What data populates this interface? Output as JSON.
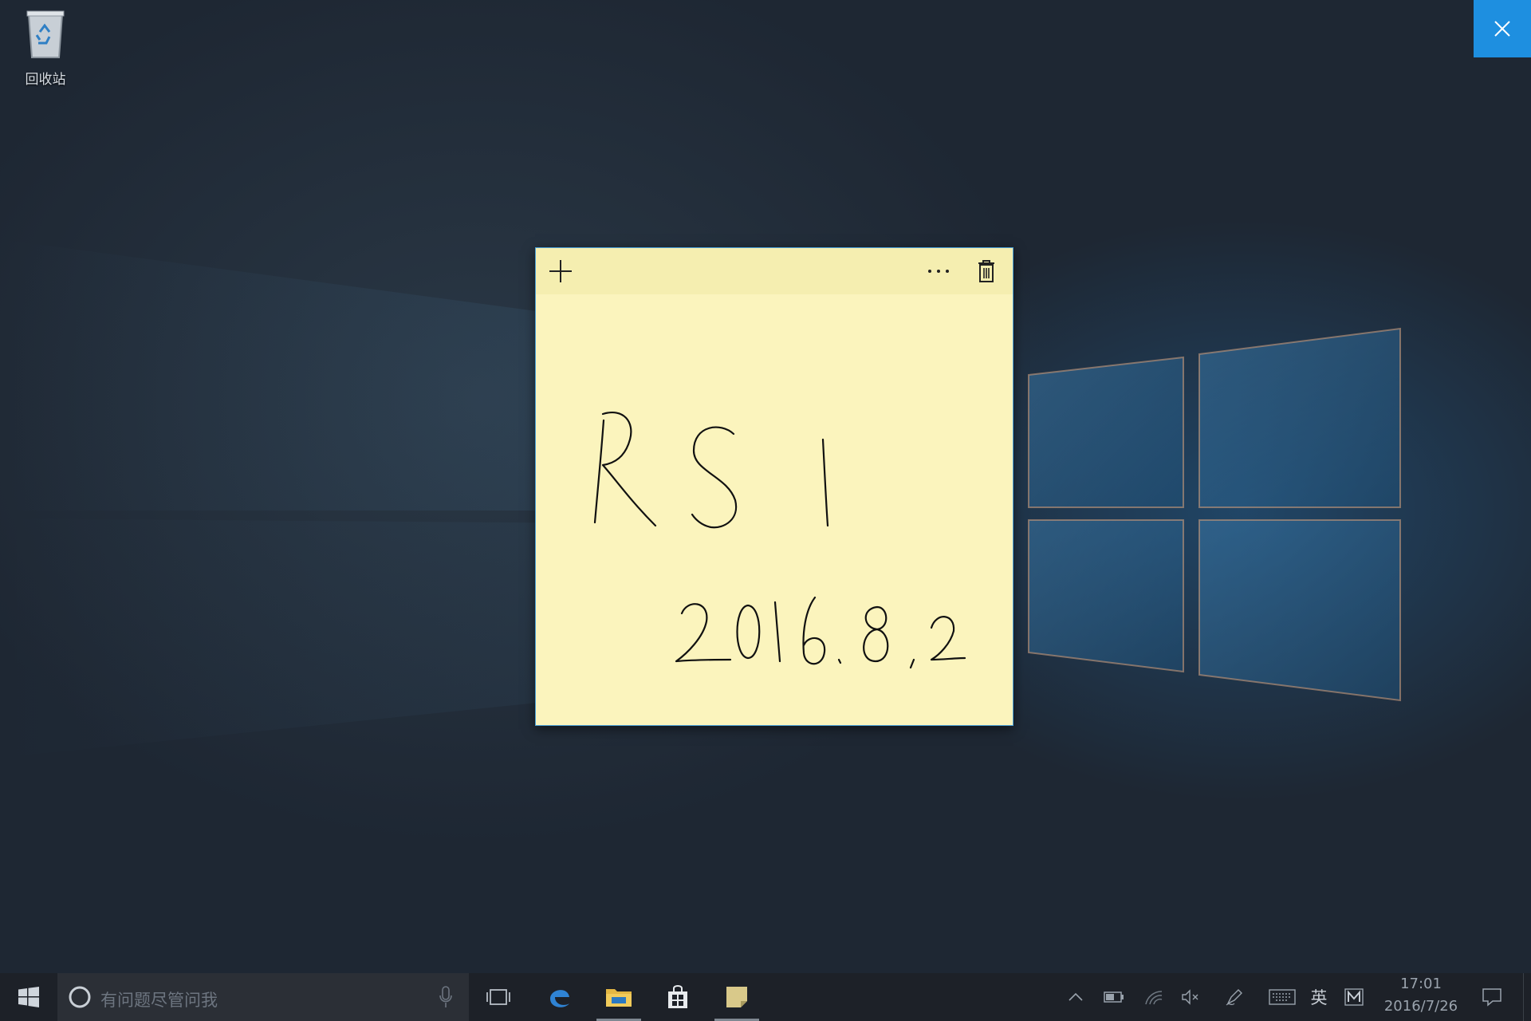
{
  "desktop": {
    "recycle_bin_label": "回收站",
    "recycle_bin_icon": "recycle-bin-icon"
  },
  "overlay": {
    "close_icon": "close-icon",
    "accent_color": "#1e8fe0"
  },
  "sticky_note": {
    "background_color": "#fbf4bd",
    "header_color": "#f5eeb0",
    "buttons": [
      {
        "name": "new-note",
        "icon": "plus-icon"
      },
      {
        "name": "menu",
        "icon": "more-icon",
        "glyph": "···"
      },
      {
        "name": "delete-note",
        "icon": "trash-icon"
      }
    ],
    "ink_lines": [
      "RSI",
      "2016.8.2"
    ]
  },
  "taskbar": {
    "search_placeholder": "有问题尽管问我",
    "pinned_apps": [
      {
        "name": "Task View",
        "icon": "task-view-icon"
      },
      {
        "name": "Microsoft Edge",
        "icon": "edge-icon"
      },
      {
        "name": "File Explorer",
        "icon": "folder-icon",
        "running": true
      },
      {
        "name": "Store",
        "icon": "store-icon"
      },
      {
        "name": "Sticky Notes",
        "icon": "sticky-notes-icon",
        "running": true
      }
    ],
    "tray": {
      "ime_label": "英",
      "ime_mode": "M"
    },
    "clock": {
      "time": "17:01",
      "date": "2016/7/26"
    }
  }
}
